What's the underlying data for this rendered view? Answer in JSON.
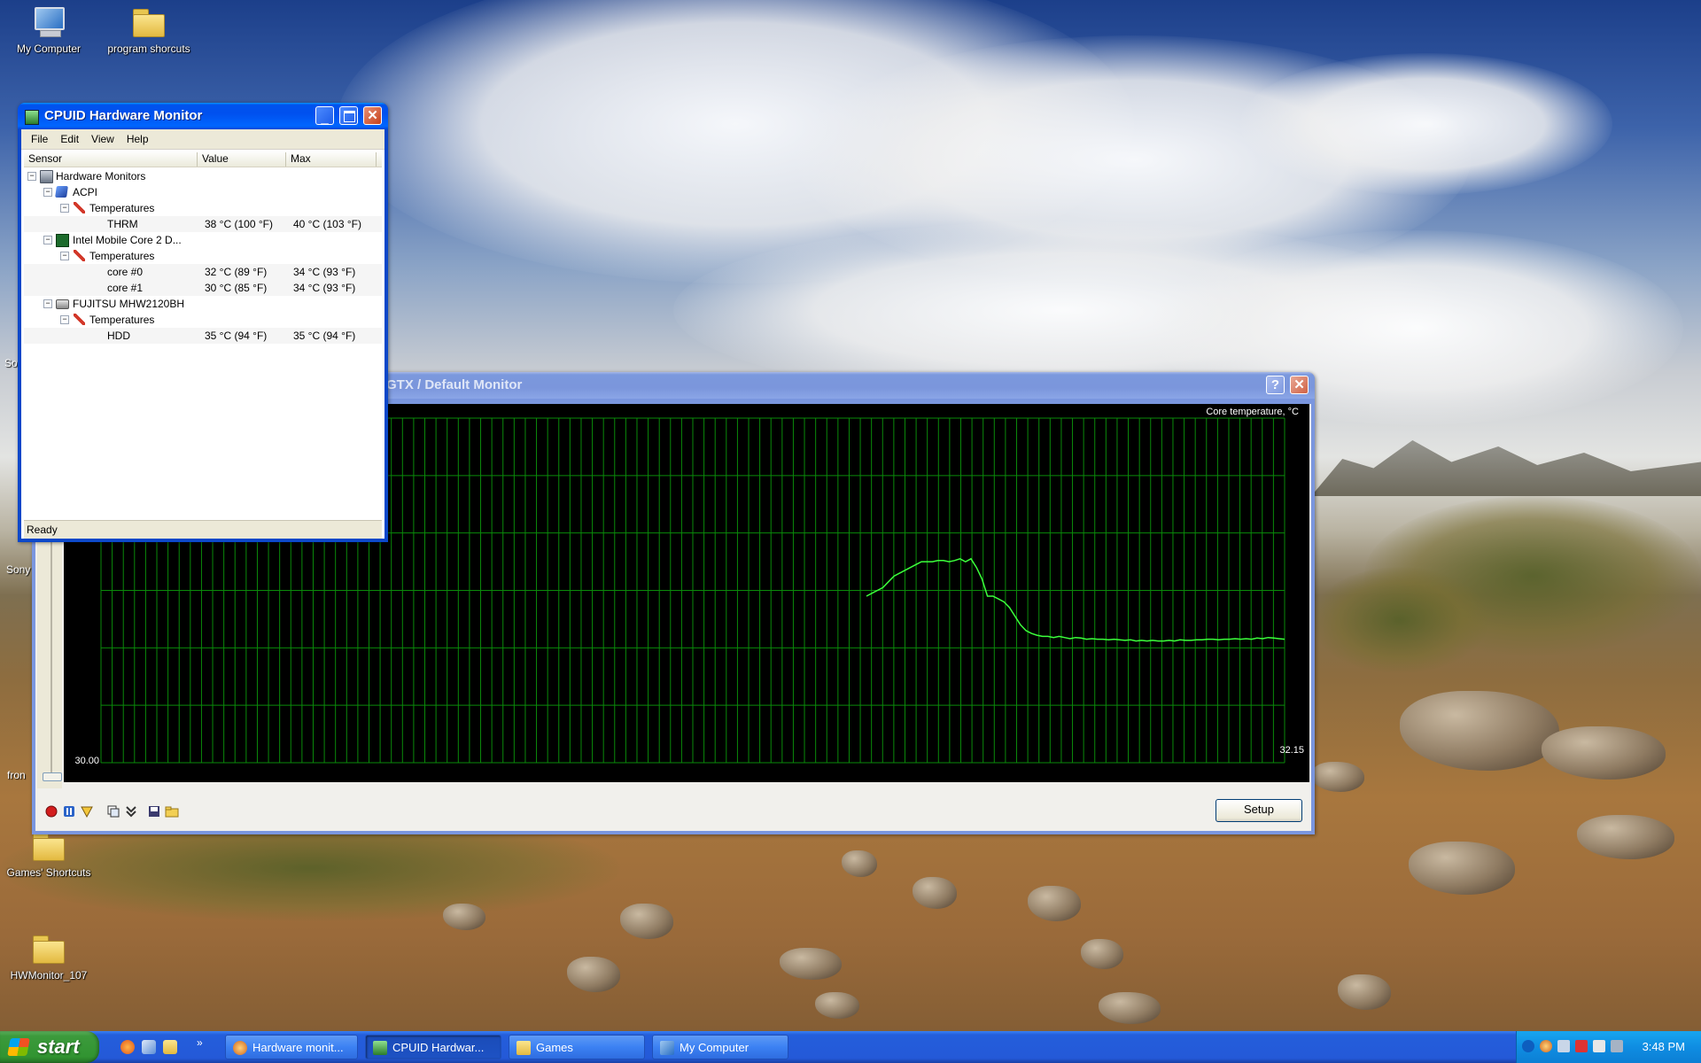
{
  "desktop": {
    "icons": [
      {
        "label": "My Computer"
      },
      {
        "label": "program shorcuts"
      },
      {
        "label": "Games' Shortcuts"
      },
      {
        "label": "HWMonitor_107"
      }
    ],
    "edge_labels": [
      "So",
      "Sony",
      "fron"
    ]
  },
  "hwmonitor": {
    "title": "CPUID Hardware Monitor",
    "menu": [
      "File",
      "Edit",
      "View",
      "Help"
    ],
    "columns": [
      "Sensor",
      "Value",
      "Max"
    ],
    "tree": {
      "root": "Hardware Monitors",
      "acpi": "ACPI",
      "acpi_group": "Temperatures",
      "thrm": {
        "name": "THRM",
        "value": "38 °C  (100 °F)",
        "max": "40 °C  (103 °F)"
      },
      "cpu": "Intel Mobile Core 2 D...",
      "cpu_group": "Temperatures",
      "core0": {
        "name": "core #0",
        "value": "32 °C  (89 °F)",
        "max": "34 °C  (93 °F)"
      },
      "core1": {
        "name": "core #1",
        "value": "30 °C  (85 °F)",
        "max": "34 °C  (93 °F)"
      },
      "disk": "FUJITSU MHW2120BH",
      "disk_group": "Temperatures",
      "hdd": {
        "name": "HDD",
        "value": "35 °C  (94 °F)",
        "max": "35 °C  (94 °F)"
      }
    },
    "status": "Ready"
  },
  "monitor": {
    "title": "GTX / Default Monitor",
    "setup_label": "Setup",
    "toolbar_icons": [
      "record-icon",
      "pause-icon",
      "clear-icon",
      "copy-icon",
      "collapse-icon",
      "save-icon",
      "open-folder-icon"
    ]
  },
  "chart_data": {
    "type": "line",
    "title": "Core temperature, °C",
    "ylabel": "",
    "xlabel": "",
    "min_label": "30.00",
    "current_label": "32.15",
    "grid": true,
    "ylim": [
      30,
      36
    ],
    "series": [
      {
        "color": "#3cff3c",
        "values": [
          32.9,
          32.95,
          33.0,
          33.05,
          33.15,
          33.25,
          33.3,
          33.35,
          33.4,
          33.45,
          33.5,
          33.5,
          33.5,
          33.52,
          33.52,
          33.5,
          33.52,
          33.55,
          33.5,
          33.55,
          33.4,
          33.2,
          32.9,
          32.9,
          32.85,
          32.8,
          32.7,
          32.55,
          32.4,
          32.3,
          32.25,
          32.22,
          32.2,
          32.2,
          32.18,
          32.2,
          32.18,
          32.16,
          32.18,
          32.17,
          32.15,
          32.16,
          32.15,
          32.15,
          32.14,
          32.15,
          32.14,
          32.13,
          32.14,
          32.12,
          32.13,
          32.12,
          32.13,
          32.12,
          32.12,
          32.13,
          32.12,
          32.14,
          32.13,
          32.13,
          32.14,
          32.14,
          32.15,
          32.15,
          32.14,
          32.15,
          32.15,
          32.16,
          32.15,
          32.16,
          32.15,
          32.17,
          32.16,
          32.18,
          32.17,
          32.16,
          32.15
        ]
      }
    ]
  },
  "taskbar": {
    "start_label": "start",
    "items": [
      "Hardware monit...",
      "CPUID Hardwar...",
      "Games",
      "My Computer"
    ],
    "clock": "3:48 PM"
  },
  "colors": {
    "grid": "#0a8a0a",
    "line": "#3cff3c",
    "titlebar_active": "#0053ee"
  }
}
